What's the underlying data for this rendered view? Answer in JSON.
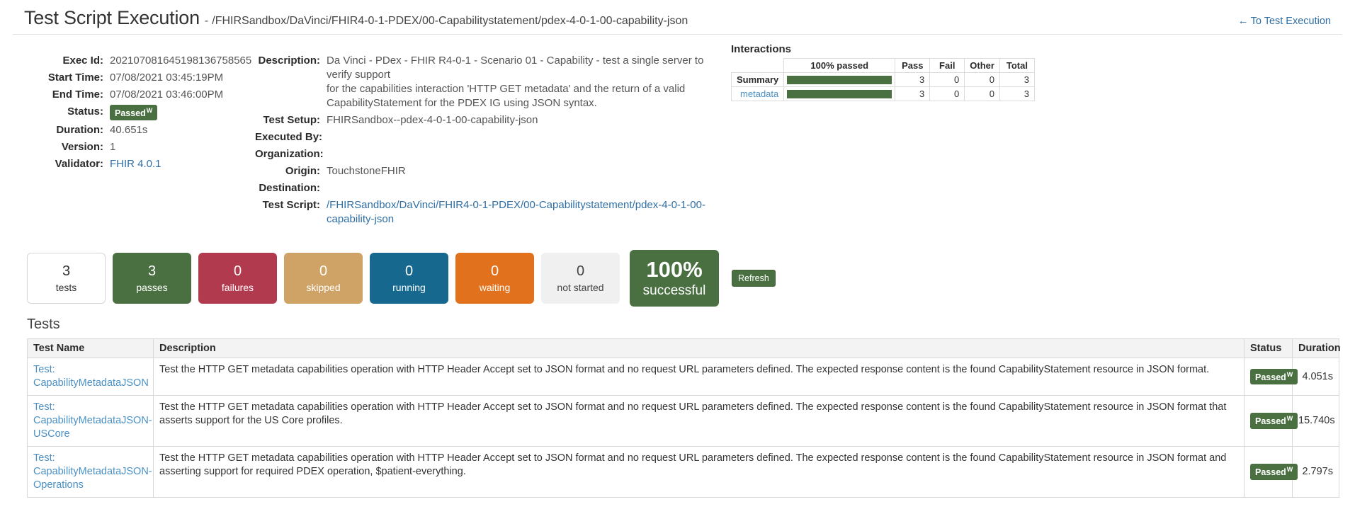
{
  "header": {
    "title": "Test Script Execution",
    "separator": "-",
    "path": "/FHIRSandbox/DaVinci/FHIR4-0-1-PDEX/00-Capabilitystatement/pdex-4-0-1-00-capability-json",
    "back_link": "To Test Execution",
    "back_arrow": "←"
  },
  "details_left": [
    {
      "label": "Exec Id:",
      "value": "202107081645198136758565",
      "type": "text"
    },
    {
      "label": "Start Time:",
      "value": "07/08/2021 03:45:19PM",
      "type": "text"
    },
    {
      "label": "End Time:",
      "value": "07/08/2021 03:46:00PM",
      "type": "text"
    },
    {
      "label": "Status:",
      "value": "Passed",
      "sup": "W",
      "type": "badge"
    },
    {
      "label": "Duration:",
      "value": "40.651s",
      "type": "text"
    },
    {
      "label": "Version:",
      "value": "1",
      "type": "text"
    },
    {
      "label": "Validator:",
      "value": "FHIR 4.0.1",
      "type": "link"
    }
  ],
  "details_mid": {
    "description_label": "Description:",
    "description_lines": [
      "Da Vinci - PDex - FHIR R4-0-1 - Scenario 01 - Capability - test a single server to verify support",
      "for the capabilities interaction 'HTTP GET metadata' and the return of a valid",
      "CapabilityStatement for the PDEX IG using JSON syntax."
    ],
    "rows": [
      {
        "label": "Test Setup:",
        "value": "FHIRSandbox--pdex-4-0-1-00-capability-json",
        "type": "text"
      },
      {
        "label": "Executed By:",
        "value": "",
        "type": "text"
      },
      {
        "label": "Organization:",
        "value": "",
        "type": "text"
      },
      {
        "label": "Origin:",
        "value": "TouchstoneFHIR",
        "type": "text"
      },
      {
        "label": "Destination:",
        "value": "",
        "type": "text"
      },
      {
        "label": "Test Script:",
        "value": "/FHIRSandbox/DaVinci/FHIR4-0-1-PDEX/00-Capabilitystatement/pdex-4-0-1-00-capability-json",
        "type": "link"
      }
    ]
  },
  "interactions": {
    "title": "Interactions",
    "columns": [
      "",
      "100% passed",
      "Pass",
      "Fail",
      "Other",
      "Total"
    ],
    "rows": [
      {
        "name": "Summary",
        "is_link": false,
        "bar_pct": 100,
        "pass": "3",
        "fail": "0",
        "other": "0",
        "total": "3"
      },
      {
        "name": "metadata",
        "is_link": true,
        "bar_pct": 100,
        "pass": "3",
        "fail": "0",
        "other": "0",
        "total": "3"
      }
    ]
  },
  "stats": [
    {
      "num": "3",
      "label": "tests",
      "style": "plain",
      "color": "#ffffff"
    },
    {
      "num": "3",
      "label": "passes",
      "style": "passes",
      "color": "#4a7042"
    },
    {
      "num": "0",
      "label": "failures",
      "style": "failures",
      "color": "#b23a4e"
    },
    {
      "num": "0",
      "label": "skipped",
      "style": "skipped",
      "color": "#cfa265"
    },
    {
      "num": "0",
      "label": "running",
      "style": "running",
      "color": "#16688e"
    },
    {
      "num": "0",
      "label": "waiting",
      "style": "waiting",
      "color": "#e2711d"
    },
    {
      "num": "0",
      "label": "not started",
      "style": "notstarted",
      "color": "#f0f0f0"
    }
  ],
  "percent_box": {
    "num": "100%",
    "label": "successful",
    "color": "#4a7042"
  },
  "refresh_label": "Refresh",
  "tests_section": {
    "heading": "Tests",
    "columns": [
      "Test Name",
      "Description",
      "Status",
      "Duration"
    ],
    "rows": [
      {
        "name_prefix": "Test:",
        "name": "CapabilityMetadataJSON",
        "description": "Test the HTTP GET metadata capabilities operation with HTTP Header Accept set to JSON format and no request URL parameters defined. The expected response content is the found CapabilityStatement resource in JSON format.",
        "status": "Passed",
        "status_sup": "W",
        "duration": "4.051s"
      },
      {
        "name_prefix": "Test:",
        "name": "CapabilityMetadataJSON-USCore",
        "description": "Test the HTTP GET metadata capabilities operation with HTTP Header Accept set to JSON format and no request URL parameters defined. The expected response content is the found CapabilityStatement resource in JSON format that asserts support for the US Core profiles.",
        "status": "Passed",
        "status_sup": "W",
        "duration": "15.740s"
      },
      {
        "name_prefix": "Test:",
        "name": "CapabilityMetadataJSON-Operations",
        "description": "Test the HTTP GET metadata capabilities operation with HTTP Header Accept set to JSON format and no request URL parameters defined. The expected response content is the found CapabilityStatement resource in JSON format and asserting support for required PDEX operation, $patient-everything.",
        "status": "Passed",
        "status_sup": "W",
        "duration": "2.797s"
      }
    ]
  }
}
